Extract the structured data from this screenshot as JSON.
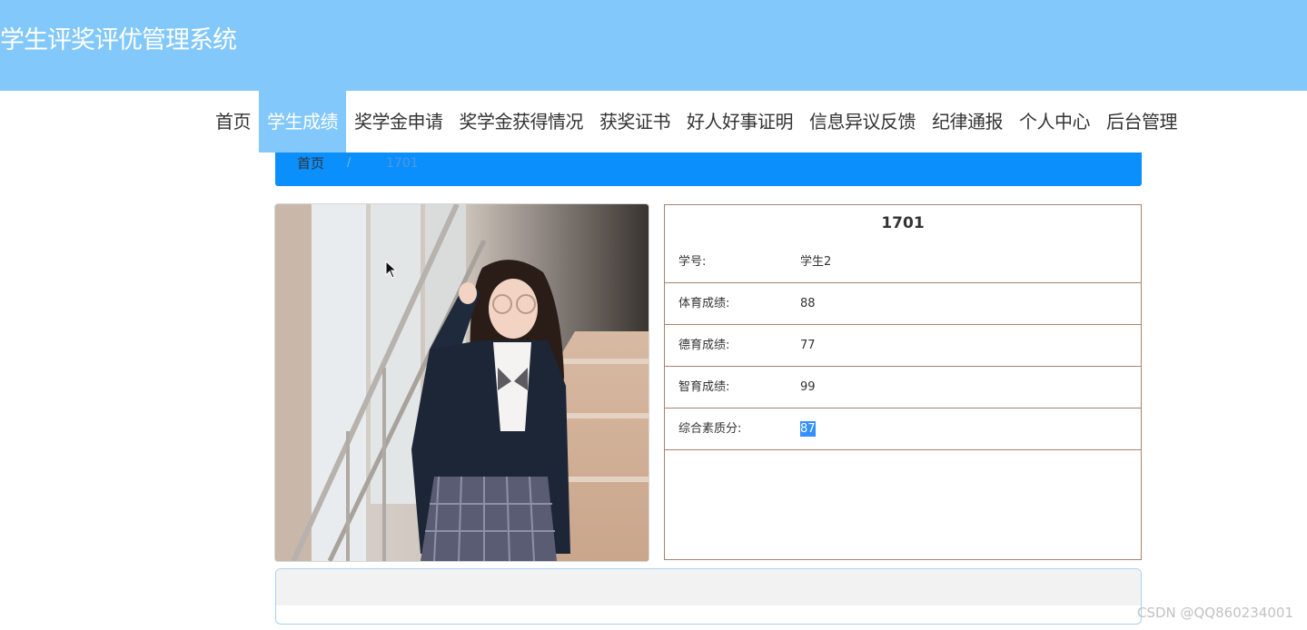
{
  "header": {
    "site_title": "学生评奖评优管理系统"
  },
  "nav": {
    "items": [
      {
        "label": "首页",
        "active": false
      },
      {
        "label": "学生成绩",
        "active": true
      },
      {
        "label": "奖学金申请",
        "active": false
      },
      {
        "label": "奖学金获得情况",
        "active": false
      },
      {
        "label": "获奖证书",
        "active": false
      },
      {
        "label": "好人好事证明",
        "active": false
      },
      {
        "label": "信息异议反馈",
        "active": false
      },
      {
        "label": "纪律通报",
        "active": false
      },
      {
        "label": "个人中心",
        "active": false
      },
      {
        "label": "后台管理",
        "active": false
      }
    ]
  },
  "breadcrumb": {
    "home": "首页",
    "separator": "/",
    "current": "1701"
  },
  "detail": {
    "title": "1701",
    "rows": [
      {
        "label": "学号:",
        "value": "学生2"
      },
      {
        "label": "体育成绩:",
        "value": "88"
      },
      {
        "label": "德育成绩:",
        "value": "77"
      },
      {
        "label": "智育成绩:",
        "value": "99"
      },
      {
        "label": "综合素质分:",
        "value": "87"
      }
    ]
  },
  "watermark": "CSDN @QQ860234001",
  "colors": {
    "header_bg": "#82c8fa",
    "breadcrumb_bg": "#0a8ffd",
    "table_border": "#a9836f",
    "selection": "#3390ff"
  }
}
